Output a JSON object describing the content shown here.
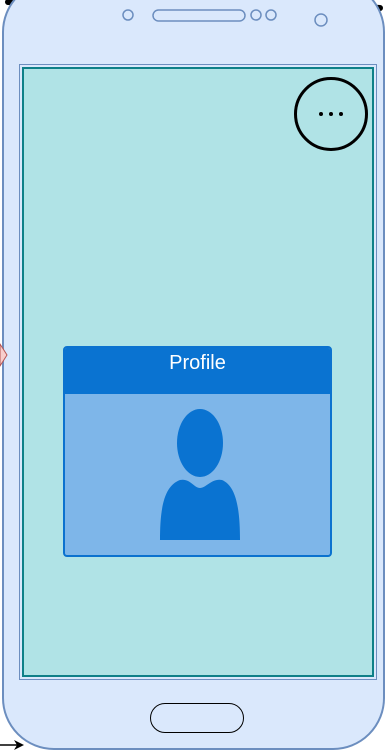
{
  "profile_card": {
    "title": "Profile"
  },
  "icons": {
    "menu": "more-horizontal-icon",
    "avatar": "user-silhouette-icon"
  },
  "colors": {
    "phone_body": "#dae8fc",
    "phone_border": "#6c8ebf",
    "screen_background": "#b0e3e6",
    "card_header": "#0a73d1",
    "card_body": "#7eb6e9"
  }
}
